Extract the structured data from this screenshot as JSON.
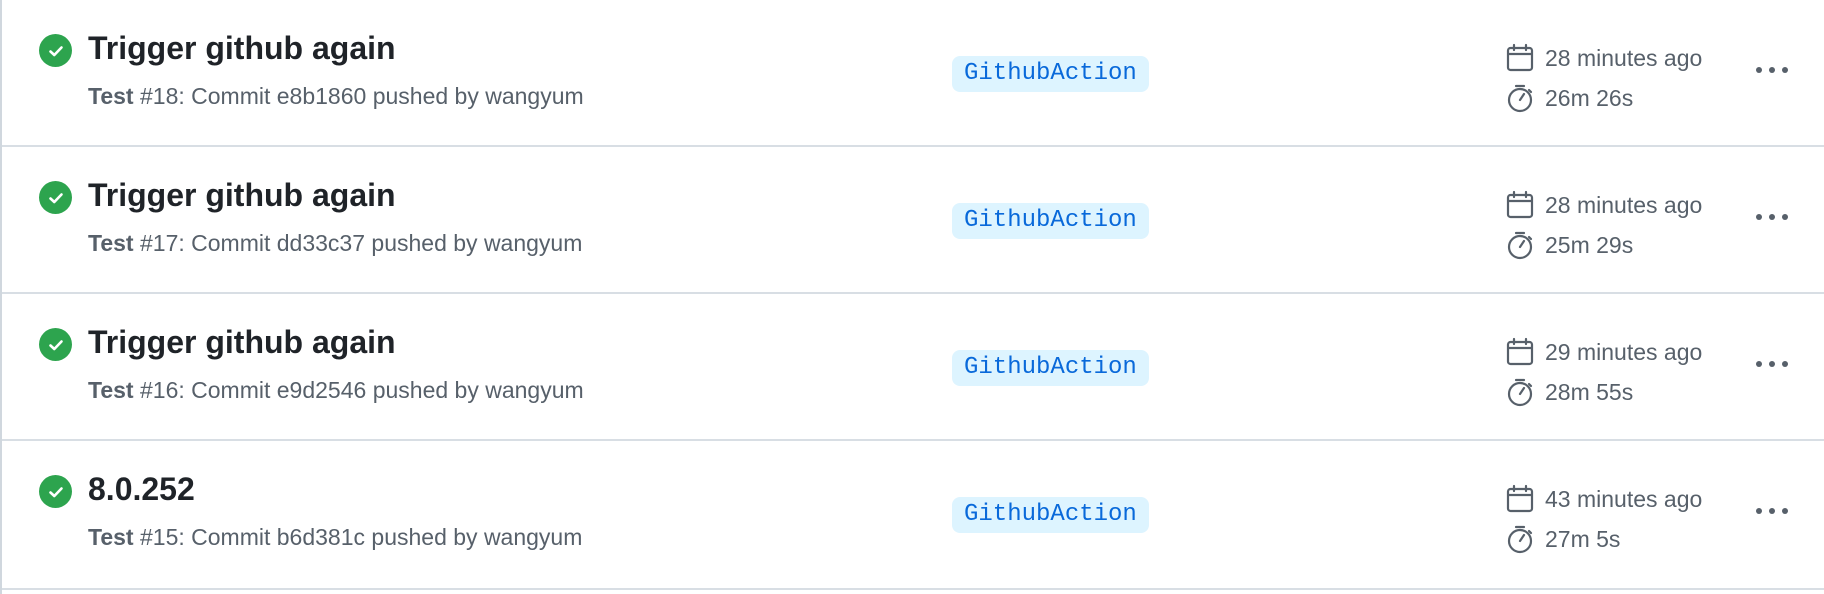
{
  "runs": [
    {
      "title": "Trigger github again",
      "workflow": "Test",
      "run_number": "#18",
      "commit_prefix": "Commit",
      "commit_sha": "e8b1860",
      "pushed_by_text": "pushed by",
      "actor": "wangyum",
      "branch": "GithubAction",
      "time_ago": "28 minutes ago",
      "duration": "26m 26s",
      "status": "success"
    },
    {
      "title": "Trigger github again",
      "workflow": "Test",
      "run_number": "#17",
      "commit_prefix": "Commit",
      "commit_sha": "dd33c37",
      "pushed_by_text": "pushed by",
      "actor": "wangyum",
      "branch": "GithubAction",
      "time_ago": "28 minutes ago",
      "duration": "25m 29s",
      "status": "success"
    },
    {
      "title": "Trigger github again",
      "workflow": "Test",
      "run_number": "#16",
      "commit_prefix": "Commit",
      "commit_sha": "e9d2546",
      "pushed_by_text": "pushed by",
      "actor": "wangyum",
      "branch": "GithubAction",
      "time_ago": "29 minutes ago",
      "duration": "28m 55s",
      "status": "success"
    },
    {
      "title": "8.0.252",
      "workflow": "Test",
      "run_number": "#15",
      "commit_prefix": "Commit",
      "commit_sha": "b6d381c",
      "pushed_by_text": "pushed by",
      "actor": "wangyum",
      "branch": "GithubAction",
      "time_ago": "43 minutes ago",
      "duration": "27m 5s",
      "status": "success"
    }
  ],
  "icons": {
    "status": "check-circle-icon",
    "date": "calendar-icon",
    "duration": "stopwatch-icon",
    "menu": "kebab-horizontal-icon"
  },
  "colors": {
    "success": "#2da44e",
    "badge_bg": "#ddf4ff",
    "badge_text": "#0969da",
    "muted_text": "#57606a",
    "title_text": "#1f2328"
  }
}
